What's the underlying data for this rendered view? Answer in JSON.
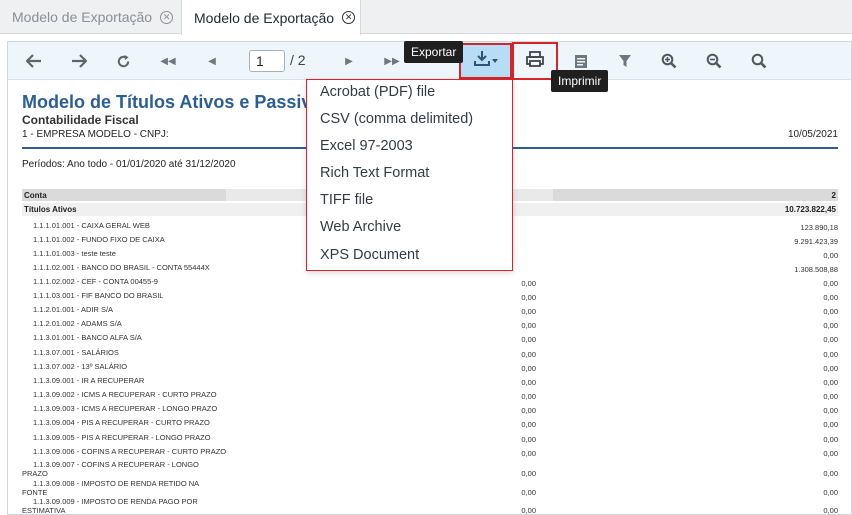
{
  "tabs": [
    {
      "label": "Modelo de Exportação"
    },
    {
      "label": "Modelo de Exportação"
    }
  ],
  "toolbar": {
    "current_page": "1",
    "total_pages": "/ 2",
    "export_tooltip": "Exportar",
    "print_tooltip": "Imprimir"
  },
  "report": {
    "title": "Modelo de Títulos Ativos e Passivos",
    "subtitle": "Contabilidade Fiscal",
    "company": "1 - EMPRESA MODELO - CNPJ:",
    "date": "10/05/2021",
    "period": "Períodos: Ano todo - 01/01/2020 até 31/12/2020",
    "header_col1": "Conta",
    "header_col2": "2",
    "group_label": "Títulos Ativos",
    "group_total": "10.723.822,45",
    "rows": [
      {
        "account": "1.1.1.01.001 - CAIXA GERAL WEB",
        "v1": "",
        "v2": "123.890,18"
      },
      {
        "account": "1.1.1.01.002 - FUNDO FIXO DE CAIXA",
        "v1": "",
        "v2": "9.291.423,39"
      },
      {
        "account": "1.1.1.01.003 - teste teste",
        "v1": "",
        "v2": "0,00"
      },
      {
        "account": "1.1.1.02.001 - BANCO DO BRASIL - CONTA 55444X",
        "v1": "",
        "v2": "1.308.508,88"
      },
      {
        "account": "1.1.1.02.002 - CEF - CONTA 00455-9",
        "v1": "0,00",
        "v2": "0,00"
      },
      {
        "account": "1.1.1.03.001 - FIF BANCO DO BRASIL",
        "v1": "0,00",
        "v2": "0,00"
      },
      {
        "account": "1.1.2.01.001 - ADIR S/A",
        "v1": "0,00",
        "v2": "0,00"
      },
      {
        "account": "1.1.2.01.002 - ADAMS S/A",
        "v1": "0,00",
        "v2": "0,00"
      },
      {
        "account": "1.1.3.01.001 - BANCO ALFA S/A",
        "v1": "0,00",
        "v2": "0,00"
      },
      {
        "account": "1.1.3.07.001 - SALÁRIOS",
        "v1": "0,00",
        "v2": "0,00"
      },
      {
        "account": "1.1.3.07.002 - 13º SALÁRIO",
        "v1": "0,00",
        "v2": "0,00"
      },
      {
        "account": "1.1.3.09.001 - IR A RECUPERAR",
        "v1": "0,00",
        "v2": "0,00"
      },
      {
        "account": "1.1.3.09.002 - ICMS A RECUPERAR - CURTO PRAZO",
        "v1": "0,00",
        "v2": "0,00"
      },
      {
        "account": "1.1.3.09.003 - ICMS A RECUPERAR - LONGO PRAZO",
        "v1": "0,00",
        "v2": "0,00"
      },
      {
        "account": "1.1.3.09.004 - PIS A RECUPERAR - CURTO PRAZO",
        "v1": "0,00",
        "v2": "0,00"
      },
      {
        "account": "1.1.3.09.005 - PIS A RECUPERAR - LONGO PRAZO",
        "v1": "0,00",
        "v2": "0,00"
      },
      {
        "account": "1.1.3.09.006 - COFINS A RECUPERAR - CURTO PRAZO",
        "v1": "0,00",
        "v2": "0,00"
      },
      {
        "account": "1.1.3.09.007 - COFINS A RECUPERAR - LONGO PRAZO",
        "v1": "0,00",
        "v2": "0,00"
      },
      {
        "account": "1.1.3.09.008 - IMPOSTO DE RENDA RETIDO NA FONTE",
        "v1": "0,00",
        "v2": "0,00"
      },
      {
        "account": "1.1.3.09.009 - IMPOSTO DE RENDA PAGO POR ESTIMATIVA",
        "v1": "0,00",
        "v2": "0,00"
      }
    ]
  },
  "export_menu": {
    "items": [
      "Acrobat (PDF) file",
      "CSV (comma delimited)",
      "Excel 97-2003",
      "Rich Text Format",
      "TIFF file",
      "Web Archive",
      "XPS Document"
    ]
  },
  "icons": [
    "back-icon",
    "forward-icon",
    "refresh-icon",
    "first-page-icon",
    "prev-page-icon",
    "next-page-icon",
    "last-page-icon",
    "export-icon",
    "print-icon",
    "clipboard-icon",
    "filter-icon",
    "zoom-in-icon",
    "zoom-out-icon",
    "search-icon",
    "close-icon"
  ],
  "colors": {
    "accent": "#2b5e95",
    "highlight_border": "#d8232a",
    "toolbar_bg": "#eef6fc",
    "export_active": "#b7dcf5"
  }
}
